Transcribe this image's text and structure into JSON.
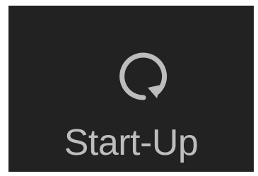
{
  "tile": {
    "icon": "restart-icon",
    "label": "Start-Up",
    "colors": {
      "background": "#222222",
      "foreground": "#bdbdbd"
    }
  }
}
